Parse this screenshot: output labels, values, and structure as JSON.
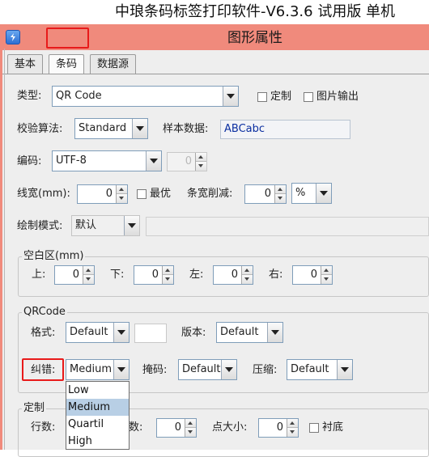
{
  "app": {
    "title": "中琅条码标签打印软件-V6.3.6 试用版 单机"
  },
  "dialog": {
    "title": "图形属性"
  },
  "tabs": [
    {
      "label": "基本",
      "active": false
    },
    {
      "label": "条码",
      "active": true
    },
    {
      "label": "数据源",
      "active": false
    }
  ],
  "form": {
    "type": {
      "label": "类型:",
      "value": "QR Code"
    },
    "custom_checkbox": {
      "label": "定制",
      "checked": false
    },
    "image_output_checkbox": {
      "label": "图片输出",
      "checked": false
    },
    "checksum": {
      "label": "校验算法:",
      "value": "Standard"
    },
    "sample_data": {
      "label": "样本数据:",
      "value": "ABCabc"
    },
    "encoding": {
      "label": "编码:",
      "value": "UTF-8",
      "aux_value": "0"
    },
    "line_width": {
      "label": "线宽(mm):",
      "value": "0"
    },
    "optimal_checkbox": {
      "label": "最优",
      "checked": false
    },
    "bar_width_reduction": {
      "label": "条宽削减:",
      "value": "0",
      "unit": "%"
    },
    "draw_mode": {
      "label": "绘制模式:",
      "value": "默认"
    },
    "quiet_zone": {
      "title": "空白区(mm)",
      "top": {
        "label": "上:",
        "value": "0"
      },
      "bottom": {
        "label": "下:",
        "value": "0"
      },
      "left": {
        "label": "左:",
        "value": "0"
      },
      "right": {
        "label": "右:",
        "value": "0"
      }
    },
    "qrcode": {
      "title": "QRCode",
      "format": {
        "label": "格式:",
        "value": "Default"
      },
      "version": {
        "label": "版本:",
        "value": "Default"
      },
      "error_correction": {
        "label": "纠错:",
        "value": "Medium",
        "options": [
          "Low",
          "Medium",
          "Quartil",
          "High"
        ],
        "highlighted": "Medium"
      },
      "mask": {
        "label": "掩码:",
        "value": "Default"
      },
      "compression": {
        "label": "压缩:",
        "value": "Default"
      }
    },
    "custom_group": {
      "title": "定制",
      "rows": {
        "label": "行数:"
      },
      "columns": {
        "label": "列数:",
        "value": "0"
      },
      "dot_size": {
        "label": "点大小:",
        "value": "0"
      },
      "background_checkbox": {
        "label": "衬底",
        "checked": false
      }
    }
  },
  "colors": {
    "titlebar": "#f08a7c",
    "focus_outline": "#e81a1a",
    "selection": "#b8cfe5"
  }
}
